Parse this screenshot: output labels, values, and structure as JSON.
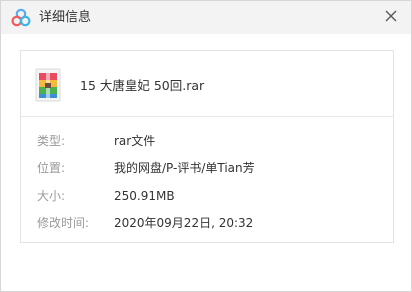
{
  "window": {
    "title": "详细信息",
    "app_icon": "cloud-icon",
    "close_icon": "close-icon"
  },
  "file": {
    "icon": "rar-archive-icon",
    "name": "15 大唐皇妃 50回.rar"
  },
  "details": [
    {
      "label": "类型:",
      "value": "rar文件"
    },
    {
      "label": "位置:",
      "value": "我的网盘/P-评书/单Tian芳"
    },
    {
      "label": "大小:",
      "value": "250.91MB"
    },
    {
      "label": "修改时间:",
      "value": "2020年09月22日, 20:32"
    }
  ],
  "colors": {
    "titlebar_bg": "#f3f3f3",
    "label_text": "#999999",
    "value_text": "#333333",
    "border": "#e3e3e3"
  }
}
